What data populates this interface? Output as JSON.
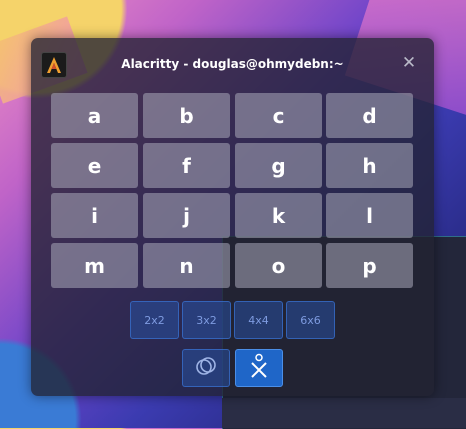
{
  "window": {
    "title": "Alacritty - douglas@ohmydebn:~",
    "close_glyph": "✕",
    "app_icon": "alacritty-icon"
  },
  "keys": [
    "a",
    "b",
    "c",
    "d",
    "e",
    "f",
    "g",
    "h",
    "i",
    "j",
    "k",
    "l",
    "m",
    "n",
    "o",
    "p"
  ],
  "layouts": [
    "2x2",
    "3x2",
    "4x4",
    "6x6"
  ],
  "tools": [
    {
      "icon": "overlap-circles-icon"
    },
    {
      "icon": "gesture-cross-icon"
    }
  ],
  "colors": {
    "key_bg": "#9a9aab",
    "accent": "#1f66c8",
    "layout_btn_text": "#7e9be0"
  }
}
